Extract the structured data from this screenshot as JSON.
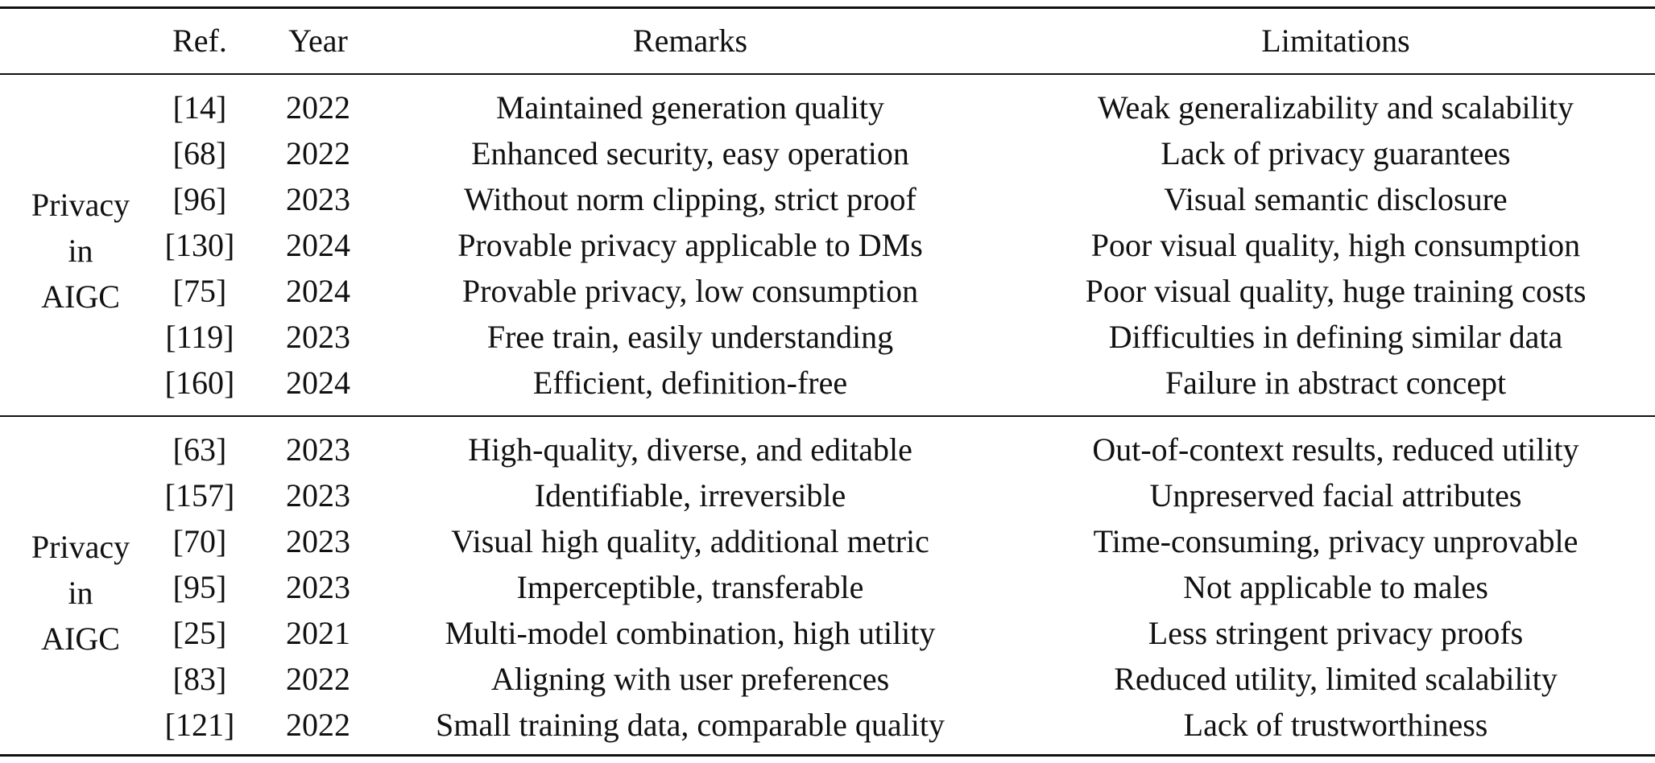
{
  "header": {
    "group": "",
    "ref": "Ref.",
    "year": "Year",
    "remarks": "Remarks",
    "limitations": "Limitations"
  },
  "groups": [
    {
      "label_lines": [
        "Privacy",
        "in",
        "AIGC"
      ],
      "rows": [
        {
          "ref": "[14]",
          "year": "2022",
          "remarks": "Maintained generation quality",
          "limitations": "Weak generalizability and scalability"
        },
        {
          "ref": "[68]",
          "year": "2022",
          "remarks": "Enhanced security, easy operation",
          "limitations": "Lack of privacy guarantees"
        },
        {
          "ref": "[96]",
          "year": "2023",
          "remarks": "Without norm clipping, strict proof",
          "limitations": "Visual semantic disclosure"
        },
        {
          "ref": "[130]",
          "year": "2024",
          "remarks": "Provable privacy applicable to DMs",
          "limitations": "Poor visual quality, high consumption"
        },
        {
          "ref": "[75]",
          "year": "2024",
          "remarks": "Provable privacy, low consumption",
          "limitations": "Poor visual quality, huge training costs"
        },
        {
          "ref": "[119]",
          "year": "2023",
          "remarks": "Free train, easily understanding",
          "limitations": "Difficulties in defining similar data"
        },
        {
          "ref": "[160]",
          "year": "2024",
          "remarks": "Efficient, definition-free",
          "limitations": "Failure in abstract concept"
        }
      ]
    },
    {
      "label_lines": [
        "Privacy",
        "in",
        "AIGC"
      ],
      "rows": [
        {
          "ref": "[63]",
          "year": "2023",
          "remarks": "High-quality, diverse, and editable",
          "limitations": "Out-of-context results, reduced utility"
        },
        {
          "ref": "[157]",
          "year": "2023",
          "remarks": "Identifiable, irreversible",
          "limitations": "Unpreserved facial attributes"
        },
        {
          "ref": "[70]",
          "year": "2023",
          "remarks": "Visual high quality, additional metric",
          "limitations": "Time-consuming, privacy unprovable"
        },
        {
          "ref": "[95]",
          "year": "2023",
          "remarks": "Imperceptible, transferable",
          "limitations": "Not applicable to males"
        },
        {
          "ref": "[25]",
          "year": "2021",
          "remarks": "Multi-model combination, high utility",
          "limitations": "Less stringent privacy proofs"
        },
        {
          "ref": "[83]",
          "year": "2022",
          "remarks": "Aligning with user preferences",
          "limitations": "Reduced utility, limited scalability"
        },
        {
          "ref": "[121]",
          "year": "2022",
          "remarks": "Small training data, comparable quality",
          "limitations": "Lack of trustworthiness"
        }
      ]
    }
  ]
}
